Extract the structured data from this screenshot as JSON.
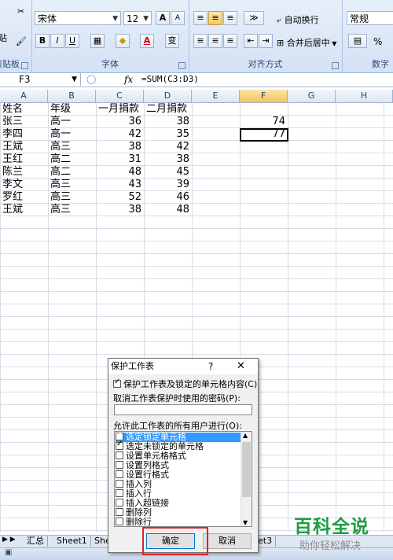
{
  "ribbon": {
    "clipboard": {
      "label": "剪贴板",
      "paste_fragment": "贴"
    },
    "font": {
      "label": "字体",
      "font_name": "宋体",
      "font_size": "12",
      "bold": "B",
      "italic": "I",
      "underline": "U",
      "grow": "A",
      "shrink": "A",
      "font_color": "A",
      "phonetic": "变"
    },
    "alignment": {
      "label": "对齐方式",
      "wrap_text": "自动换行",
      "merge_center": "合并后居中"
    },
    "number": {
      "label": "数字",
      "format": "常规",
      "percent": "%"
    }
  },
  "formula_bar": {
    "name_box": "F3",
    "fx": "fx",
    "formula": "=SUM(C3:D3)"
  },
  "columns": [
    "A",
    "B",
    "C",
    "D",
    "E",
    "F",
    "G",
    "H"
  ],
  "active_column": "F",
  "table": {
    "headers": [
      "姓名",
      "年级",
      "一月捐款",
      "二月捐款"
    ],
    "rows": [
      [
        "张三",
        "高一",
        "36",
        "38"
      ],
      [
        "李四",
        "高一",
        "42",
        "35"
      ],
      [
        "王斌",
        "高三",
        "38",
        "42"
      ],
      [
        "王红",
        "高二",
        "31",
        "38"
      ],
      [
        "陈兰",
        "高二",
        "48",
        "45"
      ],
      [
        "李文",
        "高三",
        "43",
        "39"
      ],
      [
        "罗红",
        "高三",
        "52",
        "46"
      ],
      [
        "王斌",
        "高三",
        "38",
        "48"
      ]
    ],
    "f_values": [
      "74",
      "77"
    ]
  },
  "sheet_tabs": [
    "汇总",
    "Sheet1",
    "She",
    "et3"
  ],
  "dialog": {
    "title": "保护工作表",
    "help": "?",
    "close": "✕",
    "protect_label": "保护工作表及锁定的单元格内容(C)",
    "password_label": "取消工作表保护时使用的密码(P):",
    "allow_label": "允许此工作表的所有用户进行(O):",
    "items": [
      "选定锁定单元格",
      "选定未锁定的单元格",
      "设置单元格格式",
      "设置列格式",
      "设置行格式",
      "插入列",
      "插入行",
      "插入超链接",
      "删除列",
      "删除行"
    ],
    "ok": "确定",
    "cancel": "取消"
  },
  "watermark": {
    "brand": "百科全说",
    "slogan": "助你轻松解决"
  }
}
